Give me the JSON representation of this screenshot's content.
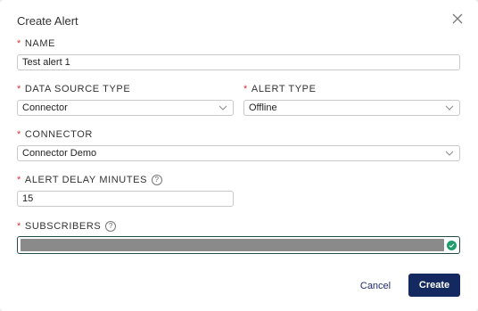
{
  "dialog": {
    "title": "Create Alert",
    "close_icon": "close-icon"
  },
  "fields": {
    "name": {
      "label": "NAME",
      "value": "Test alert 1",
      "required": true
    },
    "data_source_type": {
      "label": "DATA SOURCE TYPE",
      "value": "Connector",
      "required": true
    },
    "alert_type": {
      "label": "ALERT TYPE",
      "value": "Offline",
      "required": true
    },
    "connector": {
      "label": "CONNECTOR",
      "value": "Connector Demo",
      "required": true
    },
    "alert_delay_minutes": {
      "label": "ALERT DELAY MINUTES",
      "value": "15",
      "required": true,
      "help_icon": "help-icon"
    },
    "subscribers": {
      "label": "SUBSCRIBERS",
      "required": true,
      "help_icon": "help-icon",
      "valid": true
    }
  },
  "required_marker": "*",
  "help_glyph": "?",
  "actions": {
    "cancel_label": "Cancel",
    "create_label": "Create"
  },
  "colors": {
    "required": "#d9363e",
    "primary_button": "#14295f",
    "valid_check": "#1f9d6b"
  }
}
